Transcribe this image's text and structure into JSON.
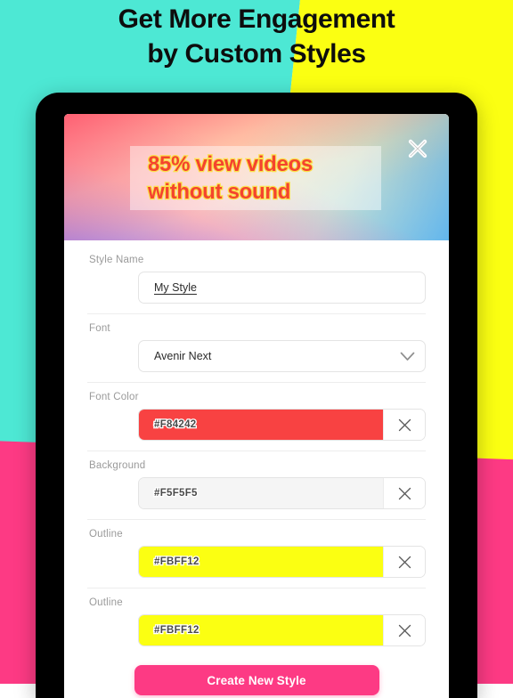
{
  "headline": {
    "line1": "Get More Engagement",
    "line2": "by Custom Styles"
  },
  "background": {
    "teal": "#4DE8D4",
    "yellow": "#FBFF12",
    "pink": "#FD3A84"
  },
  "banner": {
    "line1": "85% view videos",
    "line2": "without sound",
    "text_color": "#F4442E",
    "outline_color": "#FBE14A",
    "close_icon": "close-icon"
  },
  "form": {
    "style_name": {
      "label": "Style Name",
      "value": "My Style",
      "placeholder": "Style Name"
    },
    "font": {
      "label": "Font",
      "value": "Avenir Next",
      "chevron_icon": "chevron-down-icon"
    },
    "font_color": {
      "label": "Font Color",
      "value": "#F84242",
      "swatch": "#F84242",
      "clear_icon": "close-icon"
    },
    "background": {
      "label": "Background",
      "value": "#F5F5F5",
      "swatch": "#F5F5F5",
      "clear_icon": "close-icon"
    },
    "outline_1": {
      "label": "Outline",
      "value": "#FBFF12",
      "swatch": "#FBFF12",
      "clear_icon": "close-icon"
    },
    "outline_2": {
      "label": "Outline",
      "value": "#FBFF12",
      "swatch": "#FBFF12",
      "clear_icon": "close-icon"
    },
    "submit": {
      "label": "Create New Style",
      "color": "#FD3A84"
    }
  }
}
